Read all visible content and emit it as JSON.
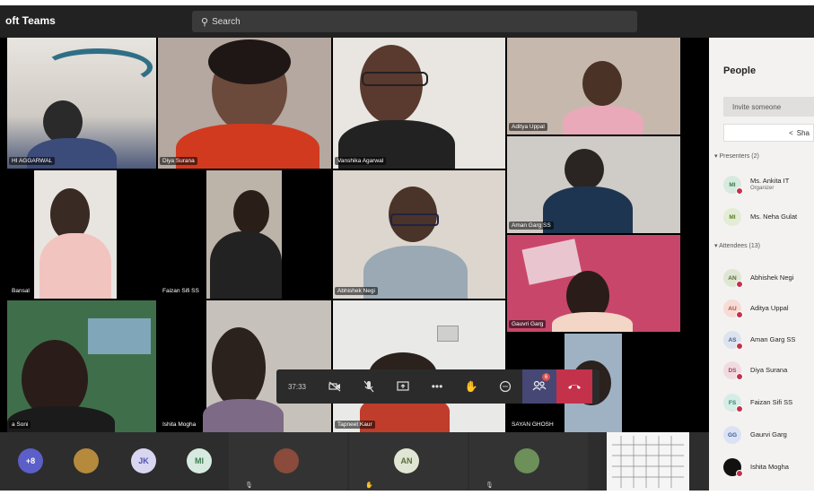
{
  "app": {
    "title": "oft Teams"
  },
  "search": {
    "icon": "search-icon",
    "label": "Search"
  },
  "participants": [
    {
      "label": "HI AGGARWAL"
    },
    {
      "label": "Diya Surana"
    },
    {
      "label": "Vanshika Agarwal"
    },
    {
      "label": "Aditya Uppal"
    },
    {
      "label": "Aman Garg SS"
    },
    {
      "label": "Bansal"
    },
    {
      "label": "Faizan Sifi SS"
    },
    {
      "label": "Abhishek Negi"
    },
    {
      "label": "Gauvri Garg"
    },
    {
      "label": "a Soni"
    },
    {
      "label": "Ishita Mogha"
    },
    {
      "label": "Tapneet Kaur"
    },
    {
      "label": "SAYAN GHOSH"
    }
  ],
  "controls": {
    "timer": "37:33",
    "people_badge": "6"
  },
  "bottom_strip": {
    "overflow": "+8",
    "bubble_jk": "JK",
    "bubble_mi": "MI",
    "bubble_an": "AN"
  },
  "panel": {
    "title": "People",
    "invite_placeholder": "Invite someone",
    "share_label": "Sha",
    "presenters_header": "Presenters (2)",
    "attendees_header": "Attendees (13)",
    "presenters": [
      {
        "initials": "MI",
        "name": "Ms. Ankita IT",
        "role": "Organizer",
        "color": "#d7eadf",
        "fg": "#3a7d4f"
      },
      {
        "initials": "MI",
        "name": "Ms. Neha Gulat",
        "role": "",
        "color": "#e3ecd5",
        "fg": "#5b7d2a"
      }
    ],
    "attendees": [
      {
        "initials": "AN",
        "name": "Abhishek Negi",
        "color": "#dfe6d3",
        "fg": "#5a6b3a"
      },
      {
        "initials": "AU",
        "name": "Aditya Uppal",
        "color": "#f6dcd6",
        "fg": "#b24a33"
      },
      {
        "initials": "AS",
        "name": "Aman Garg SS",
        "color": "#dde3ef",
        "fg": "#44608f"
      },
      {
        "initials": "DS",
        "name": "Diya Surana",
        "color": "#f1dbe2",
        "fg": "#a34663"
      },
      {
        "initials": "FS",
        "name": "Faizan Sifi SS",
        "color": "#d6ece6",
        "fg": "#2f7d6a"
      },
      {
        "initials": "GG",
        "name": "Gaurvi Garg",
        "color": "#dbe2f3",
        "fg": "#3e5a9d"
      },
      {
        "initials": "",
        "name": "Ishita Mogha",
        "color": "#111111",
        "fg": "#ffffff"
      }
    ]
  }
}
